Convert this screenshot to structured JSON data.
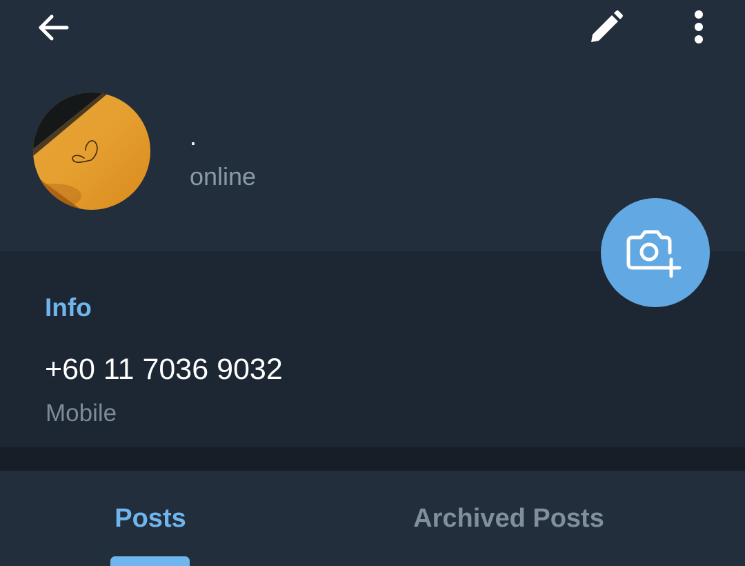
{
  "toolbar": {
    "back_icon": "arrow-left-icon",
    "edit_icon": "pencil-icon",
    "more_icon": "more-vertical-icon"
  },
  "profile": {
    "name": "·",
    "status": "online",
    "avatar_icon": "profile-photo"
  },
  "fab": {
    "icon": "camera-add-icon",
    "color": "#62a8e2"
  },
  "info": {
    "heading": "Info",
    "phone": "+60 11 7036 9032",
    "phone_label": "Mobile"
  },
  "tabs": [
    {
      "label": "Posts",
      "active": true
    },
    {
      "label": "Archived Posts",
      "active": false
    }
  ],
  "colors": {
    "header_bg": "#222e3c",
    "body_bg": "#1d2733",
    "accent": "#6fb6ee",
    "muted_text": "#8a99a9"
  }
}
